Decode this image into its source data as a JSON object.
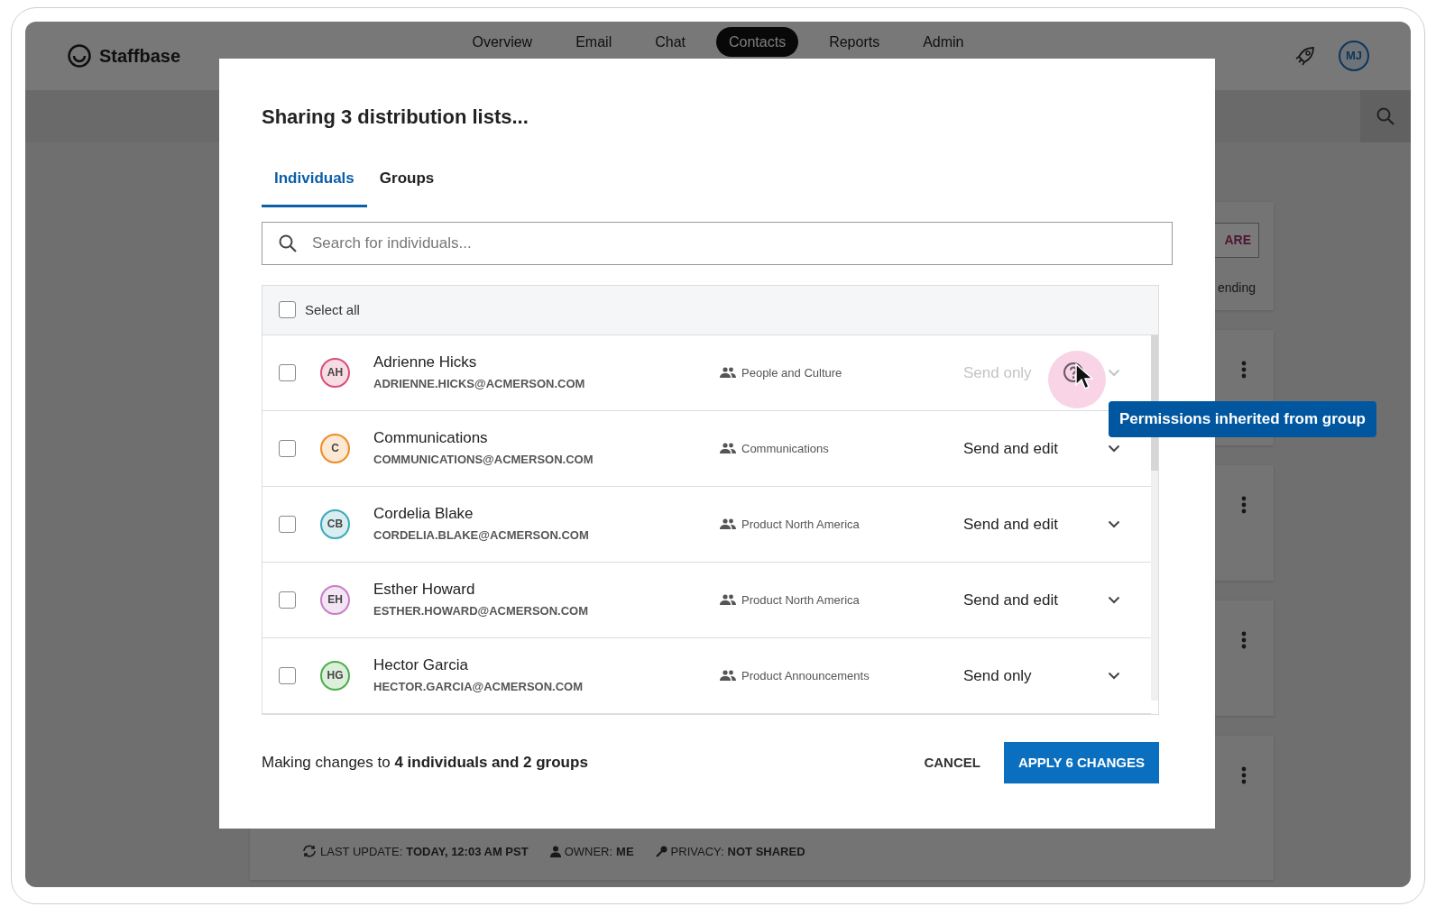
{
  "app": {
    "logo": "Staffbase",
    "user_initials": "MJ",
    "nav": [
      {
        "label": "Overview",
        "selected": false
      },
      {
        "label": "Email",
        "selected": false
      },
      {
        "label": "Chat",
        "selected": false
      },
      {
        "label": "Contacts",
        "selected": true
      },
      {
        "label": "Reports",
        "selected": false
      },
      {
        "label": "Admin",
        "selected": false
      }
    ]
  },
  "background": {
    "card_button": "ARE",
    "card_status": "ending",
    "meta": [
      {
        "kind": "update",
        "label": "LAST UPDATE:",
        "value": "TODAY, 12:03 AM PST"
      },
      {
        "kind": "owner",
        "label": "OWNER:",
        "value": "ME"
      },
      {
        "kind": "privacy",
        "label": "PRIVACY:",
        "value": "NOT SHARED"
      }
    ]
  },
  "dialog": {
    "title": "Sharing 3 distribution lists...",
    "tabs": [
      {
        "label": "Individuals",
        "selected": true
      },
      {
        "label": "Groups",
        "selected": false
      }
    ],
    "search": {
      "placeholder": "Search for individuals..."
    },
    "select_all": {
      "label": "Select all",
      "checked": false
    },
    "rows": [
      {
        "initials": "AH",
        "color": "#d94f7a",
        "name": "Adrienne Hicks",
        "email": "ADRIENNE.HICKS@ACMERSON.COM",
        "group": "People and Culture",
        "permission": "Send only",
        "disabled": true,
        "checked": false
      },
      {
        "initials": "C",
        "color": "#f08a24",
        "name": "Communications",
        "email": "COMMUNICATIONS@ACMERSON.COM",
        "group": "Communications",
        "permission": "Send and edit",
        "disabled": false,
        "checked": false
      },
      {
        "initials": "CB",
        "color": "#3aa9b8",
        "name": "Cordelia Blake",
        "email": "CORDELIA.BLAKE@ACMERSON.COM",
        "group": "Product North America",
        "permission": "Send and edit",
        "disabled": false,
        "checked": false
      },
      {
        "initials": "EH",
        "color": "#c57fc9",
        "name": "Esther Howard",
        "email": "ESTHER.HOWARD@ACMERSON.COM",
        "group": "Product North America",
        "permission": "Send and edit",
        "disabled": false,
        "checked": false
      },
      {
        "initials": "HG",
        "color": "#4cae4c",
        "name": "Hector Garcia",
        "email": "HECTOR.GARCIA@ACMERSON.COM",
        "group": "Product Announcements",
        "permission": "Send only",
        "disabled": false,
        "checked": false
      }
    ],
    "tooltip": "Permissions inherited from group",
    "summary": "Making changes to **4 individuals and 2 groups**",
    "buttons": [
      {
        "label": "CANCEL",
        "kind": "text"
      },
      {
        "label": "APPLY 6 CHANGES",
        "kind": "primary"
      }
    ]
  }
}
